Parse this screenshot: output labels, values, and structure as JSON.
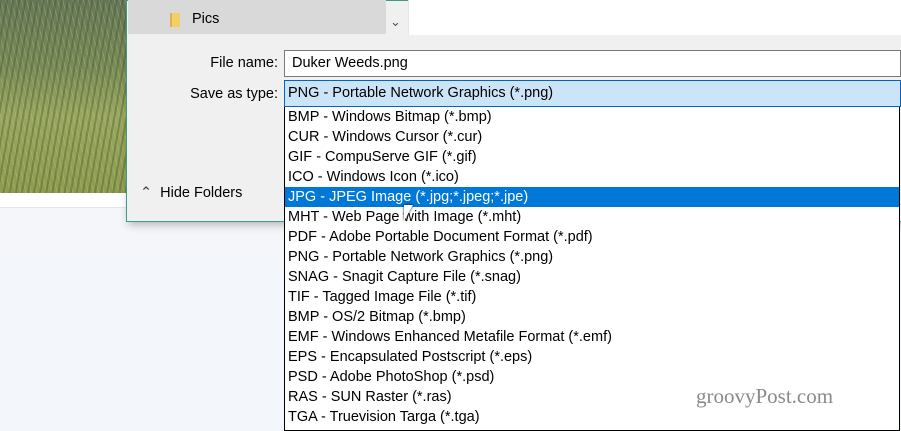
{
  "folder": {
    "label": "Pics"
  },
  "form": {
    "file_name_label": "File name:",
    "file_name_value": "Duker Weeds.png",
    "save_type_label": "Save as type:",
    "save_type_value": "PNG - Portable Network Graphics (*.png)"
  },
  "hide_folders": "Hide Folders",
  "types": [
    "BMP - Windows Bitmap (*.bmp)",
    "CUR - Windows Cursor (*.cur)",
    "GIF - CompuServe GIF (*.gif)",
    "ICO - Windows Icon (*.ico)",
    "JPG - JPEG Image (*.jpg;*.jpeg;*.jpe)",
    "MHT - Web Page with Image (*.mht)",
    "PDF - Adobe Portable Document Format (*.pdf)",
    "PNG - Portable Network Graphics (*.png)",
    "SNAG - Snagit Capture File (*.snag)",
    "TIF - Tagged Image File (*.tif)",
    "BMP - OS/2 Bitmap (*.bmp)",
    "EMF - Windows Enhanced Metafile Format (*.emf)",
    "EPS - Encapsulated Postscript (*.eps)",
    "PSD - Adobe PhotoShop (*.psd)",
    "RAS - SUN Raster (*.ras)",
    "TGA - Truevision Targa (*.tga)"
  ],
  "highlighted_index": 4,
  "watermark": "groovyPost.com"
}
